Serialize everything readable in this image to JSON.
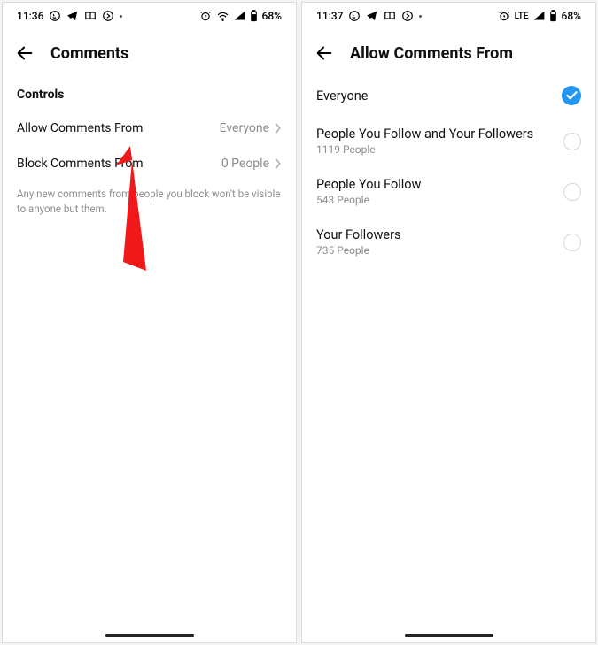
{
  "left": {
    "statusbar": {
      "time": "11:36",
      "battery": "68%"
    },
    "header": {
      "title": "Comments"
    },
    "sectionHeading": "Controls",
    "settings": {
      "allow": {
        "label": "Allow Comments From",
        "value": "Everyone"
      },
      "block": {
        "label": "Block Comments From",
        "value": "0 People"
      }
    },
    "helper": "Any new comments from people you block won't be visible to anyone but them."
  },
  "right": {
    "statusbar": {
      "time": "11:37",
      "lte": "LTE",
      "battery": "68%"
    },
    "header": {
      "title": "Allow Comments From"
    },
    "options": {
      "everyone": {
        "label": "Everyone"
      },
      "followMutual": {
        "label": "People You Follow and Your Followers",
        "sub": "1119 People"
      },
      "following": {
        "label": "People You Follow",
        "sub": "543 People"
      },
      "followers": {
        "label": "Your Followers",
        "sub": "735 People"
      }
    }
  }
}
